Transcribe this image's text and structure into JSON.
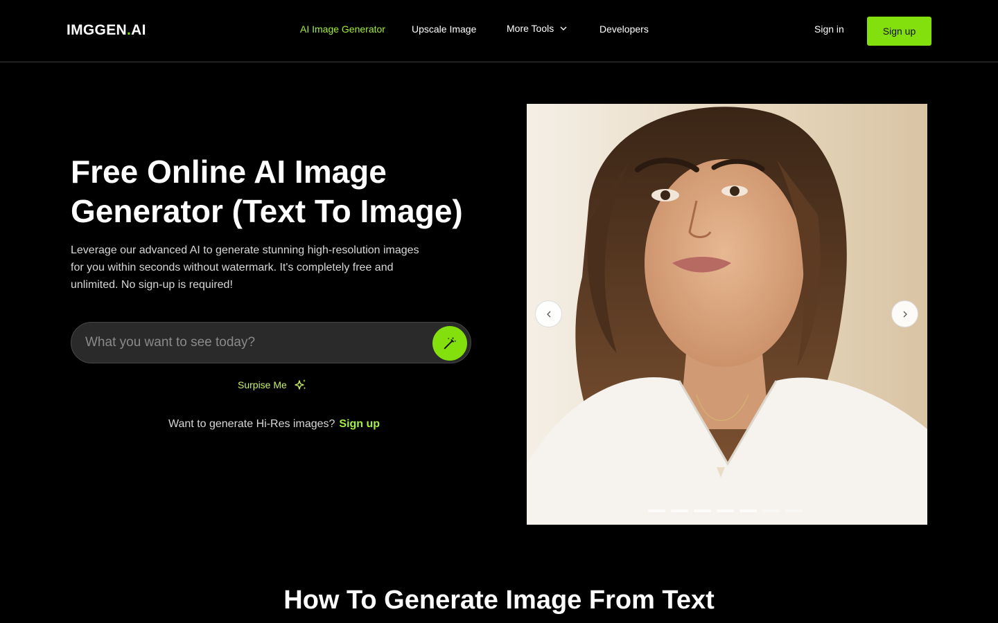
{
  "header": {
    "logo_main": "IMGGEN",
    "logo_dot": ".",
    "logo_suffix": "AI",
    "nav": {
      "generator": "AI Image Generator",
      "upscale": "Upscale Image",
      "more_tools": "More Tools",
      "developers": "Developers"
    },
    "sign_in": "Sign in",
    "sign_up": "Sign up"
  },
  "hero": {
    "title": "Free Online AI Image Generator (Text To Image)",
    "subtitle": "Leverage our advanced AI to generate stunning high-resolution images for you within seconds without watermark. It's completely free and unlimited. No sign-up is required!",
    "prompt_placeholder": "What you want to see today?",
    "prompt_value": "",
    "surprise_label": "Surpise Me",
    "hires_text": "Want to generate Hi-Res images?",
    "hires_link": "Sign up"
  },
  "carousel": {
    "active_index": 4,
    "slide_count": 7
  },
  "section": {
    "title": "How To Generate Image From Text"
  },
  "colors": {
    "accent": "#84e00d",
    "accent_text": "#a4f03a",
    "background": "#000000"
  },
  "icons": [
    "chevron-down-icon",
    "magic-wand-icon",
    "sparkles-icon",
    "chevron-left-icon",
    "chevron-right-icon"
  ]
}
